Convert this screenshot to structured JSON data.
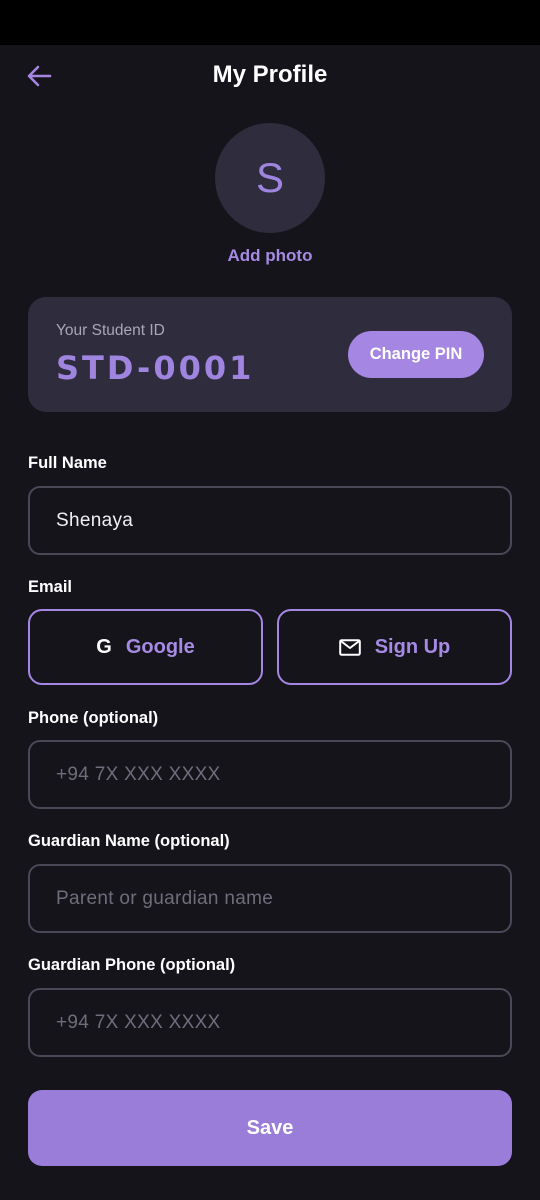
{
  "header": {
    "title": "My Profile",
    "back_icon": "arrow-left-icon"
  },
  "avatar": {
    "initial": "S",
    "add_photo_label": "Add photo"
  },
  "student_card": {
    "label": "Your Student ID",
    "id": "STD-0001",
    "change_pin_label": "Change PIN"
  },
  "form": {
    "full_name": {
      "label": "Full Name",
      "value": "Shenaya",
      "placeholder": ""
    },
    "email": {
      "label": "Email",
      "google": {
        "icon_text": "G",
        "label": "Google"
      },
      "signup": {
        "icon": "mail-icon",
        "label": "Sign Up"
      }
    },
    "phone": {
      "label": "Phone (optional)",
      "value": "",
      "placeholder": "+94 7X XXX XXXX"
    },
    "guardian_name": {
      "label": "Guardian Name (optional)",
      "value": "",
      "placeholder": "Parent or guardian name"
    },
    "guardian_phone": {
      "label": "Guardian Phone (optional)",
      "value": "",
      "placeholder": "+94 7X XXX XXXX"
    }
  },
  "save_label": "Save",
  "colors": {
    "background": "#15141b",
    "card": "#2f2d3d",
    "accent": "#a586e2",
    "save_button": "#9a7dd9",
    "input_border": "#4a4857"
  }
}
